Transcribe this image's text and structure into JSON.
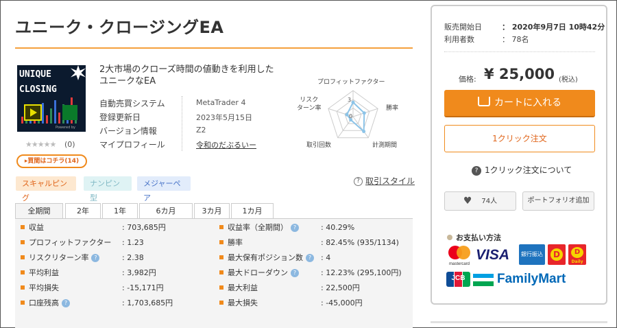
{
  "product": {
    "title": "ユニーク・クロージングEA",
    "thumb_line1": "UNIQUE",
    "thumb_line2": "CLOSING",
    "thumb_footer": "Powered by",
    "stars": "★★★★★",
    "review_count": "(0)",
    "buy_button": "▸買間はコチラ(14)",
    "description": "2大市場のクローズ時間の値動きを利用したユニークなEA"
  },
  "info": [
    {
      "label": "自動売買システム",
      "value": "MetaTrader 4",
      "link": false
    },
    {
      "label": "登録更新日",
      "value": "2023年5月15日",
      "link": false
    },
    {
      "label": "バージョン情報",
      "value": "Z2",
      "link": false
    },
    {
      "label": "マイプロフィール",
      "value": "令和のだぶるいー",
      "link": true
    }
  ],
  "radar": {
    "labels": {
      "top": "プロフィットファクター",
      "right_top": "勝率",
      "right_bottom": "計測期間",
      "left_bottom": "取引回数",
      "left_top": "リスク\nターン率"
    },
    "ticks": [
      "3",
      "0"
    ],
    "values": [
      0.55,
      0.45,
      0.7,
      0.15,
      0.25
    ],
    "colors": {
      "grid": "#cccccc",
      "series": "#8cc4e8"
    }
  },
  "tags": [
    "スキャルピング",
    "ナンピン型",
    "メジャーペア"
  ],
  "style_link": "取引スタイル",
  "tabs": [
    "全期間",
    "2年",
    "1年",
    "6カ月",
    "3カ月",
    "1カ月"
  ],
  "stats_left": [
    {
      "label": "収益",
      "value": ": 703,685円",
      "help": false
    },
    {
      "label": "プロフィットファクター",
      "value": ": 1.23",
      "help": false
    },
    {
      "label": "リスクリターン率",
      "value": ": 2.38",
      "help": true
    },
    {
      "label": "平均利益",
      "value": ": 3,982円",
      "help": false
    },
    {
      "label": "平均損失",
      "value": ": -15,171円",
      "help": false
    },
    {
      "label": "口座残高",
      "value": ": 1,703,685円",
      "help": true
    }
  ],
  "stats_right": [
    {
      "label": "収益率（全期間）",
      "value": ": 40.29%",
      "help": true
    },
    {
      "label": "勝率",
      "value": ": 82.45% (935/1134)",
      "help": false
    },
    {
      "label": "最大保有ポジション数",
      "value": ": 4",
      "help": true
    },
    {
      "label": "最大ドローダウン",
      "value": ": 12.23% (295,100円)",
      "help": true
    },
    {
      "label": "最大利益",
      "value": ": 22,500円",
      "help": false
    },
    {
      "label": "最大損失",
      "value": ": -45,000円",
      "help": false
    }
  ],
  "side": {
    "sale_start_label": "販売開始日",
    "sale_start_value": "：  2020年9月7日 10時42分",
    "users_label": "利用者数",
    "users_value": "：  78名",
    "price_label": "価格:",
    "price_value": "¥ 25,000",
    "price_tax": "(税込)",
    "cart_button": "カートに入れる",
    "oneclick_button": "1クリック注文",
    "oneclick_about": "1クリック注文について",
    "likes": "74人",
    "portfolio_button": "ポートフォリオ追加",
    "payment_title": "お支払い方法",
    "pay_visa": "VISA",
    "pay_bank": "銀行振込",
    "pay_mc": "mastercard",
    "pay_jcb": "JCB",
    "pay_familymart": "FamilyMart",
    "pay_daily": "Daily"
  },
  "colors": {
    "accent": "#f08a1c",
    "accent_text": "#e0651a"
  }
}
